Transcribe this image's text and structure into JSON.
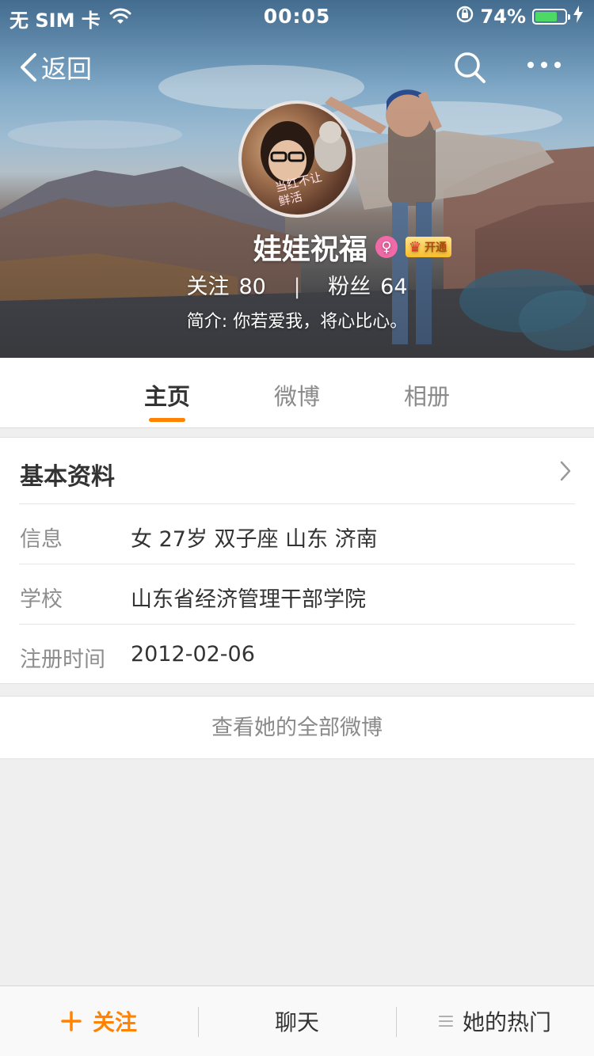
{
  "status_bar": {
    "carrier": "无 SIM 卡",
    "time": "00:05",
    "battery_percent": "74%",
    "battery_level": 0.74,
    "icons": [
      "wifi-icon",
      "rotation-lock-icon",
      "battery-icon",
      "charging-icon"
    ]
  },
  "nav": {
    "back_label": "返回",
    "icons": [
      "chevron-left-icon",
      "search-icon",
      "more-icon"
    ]
  },
  "profile": {
    "name": "娃娃祝福",
    "avatar_text_line1": "当红不让",
    "avatar_text_line2": "鲜活",
    "vip_label": "开通",
    "following_label": "关注",
    "following_count": "80",
    "separator": "|",
    "followers_label": "粉丝",
    "followers_count": "64",
    "bio": "简介: 你若爱我，将心比心。",
    "gender_color": "#f06aa7"
  },
  "tabs": [
    {
      "label": "主页",
      "active": true
    },
    {
      "label": "微博",
      "active": false
    },
    {
      "label": "相册",
      "active": false
    }
  ],
  "basic_info": {
    "title": "基本资料",
    "rows": [
      {
        "label": "信息",
        "value": "女  27岁  双子座  山东 济南"
      },
      {
        "label": "学校",
        "value": "山东省经济管理干部学院"
      },
      {
        "label": "注册时间",
        "value": "2012-02-06"
      }
    ]
  },
  "view_all_label": "查看她的全部微博",
  "bottom_bar": {
    "follow_label": "关注",
    "chat_label": "聊天",
    "hot_label": "她的热门"
  },
  "colors": {
    "accent": "#ff8200",
    "battery_green": "#4cd964"
  }
}
